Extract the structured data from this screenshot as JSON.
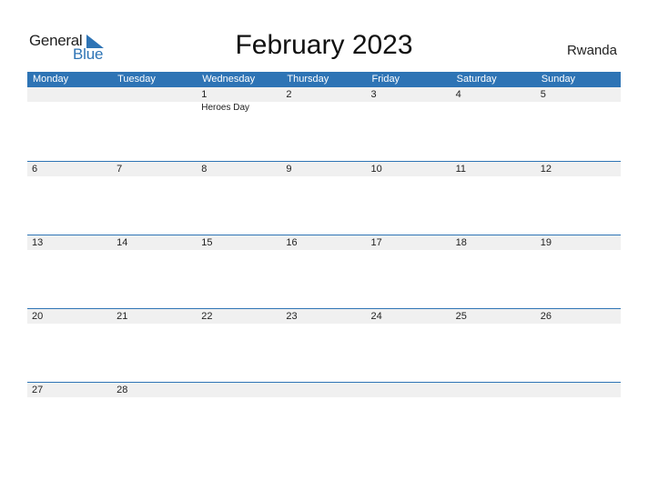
{
  "logo": {
    "part1": "General",
    "part2": "Blue"
  },
  "title": "February 2023",
  "country": "Rwanda",
  "colors": {
    "accent": "#2E74B5",
    "strip": "#F0F0F0"
  },
  "weekdays": [
    "Monday",
    "Tuesday",
    "Wednesday",
    "Thursday",
    "Friday",
    "Saturday",
    "Sunday"
  ],
  "weeks": [
    {
      "days": [
        "",
        "",
        "1",
        "2",
        "3",
        "4",
        "5"
      ],
      "events": [
        "",
        "",
        "Heroes Day",
        "",
        "",
        "",
        ""
      ]
    },
    {
      "days": [
        "6",
        "7",
        "8",
        "9",
        "10",
        "11",
        "12"
      ],
      "events": [
        "",
        "",
        "",
        "",
        "",
        "",
        ""
      ]
    },
    {
      "days": [
        "13",
        "14",
        "15",
        "16",
        "17",
        "18",
        "19"
      ],
      "events": [
        "",
        "",
        "",
        "",
        "",
        "",
        ""
      ]
    },
    {
      "days": [
        "20",
        "21",
        "22",
        "23",
        "24",
        "25",
        "26"
      ],
      "events": [
        "",
        "",
        "",
        "",
        "",
        "",
        ""
      ]
    },
    {
      "days": [
        "27",
        "28",
        "",
        "",
        "",
        "",
        ""
      ],
      "events": [
        "",
        "",
        "",
        "",
        "",
        "",
        ""
      ]
    }
  ]
}
